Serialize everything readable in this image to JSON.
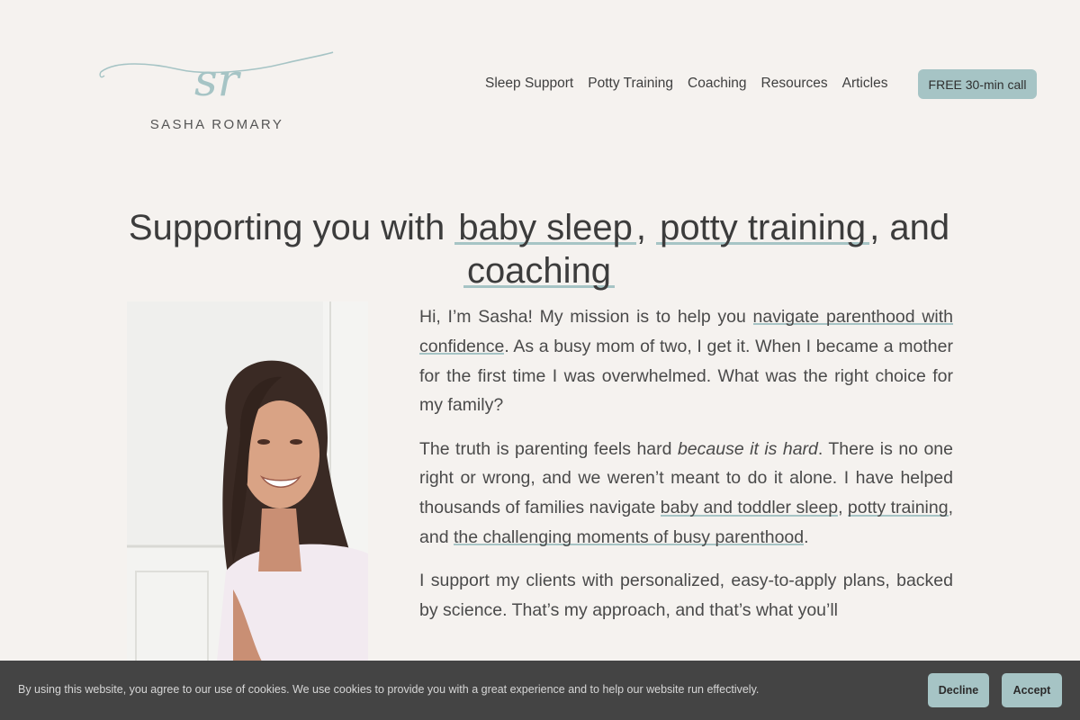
{
  "brand": {
    "monogram": "sr",
    "name": "SASHA ROMARY"
  },
  "nav": {
    "items": [
      "Sleep Support",
      "Potty Training",
      "Coaching",
      "Resources",
      "Articles"
    ],
    "cta": "FREE 30-min call"
  },
  "hero": {
    "headline_prefix": "Supporting you with ",
    "link1": "baby sleep",
    "sep1": ", ",
    "link2": "potty training",
    "sep2": ", and",
    "link3": "coaching"
  },
  "about": {
    "p1_link": "navigate parenthood with confidence",
    "p1_a": "Hi, I’m Sasha! My mission is to help you ",
    "p1_b": ". As a busy mom of two, I get it. When I became a mother for the first time I was overwhelmed. What was the right choice for my family?",
    "p2_a": "The truth is parenting feels hard ",
    "p2_em": "because it is hard",
    "p2_b": ". There is no one right or wrong, and we weren’t meant to do it alone. I have helped thousands of families navigate ",
    "p2_link1": "baby and toddler sleep",
    "p2_c": ", ",
    "p2_link2": "potty training",
    "p2_d": ", and ",
    "p2_link3": "the challenging moments of busy parenthood",
    "p2_e": ".",
    "p3": "I support my clients with personalized, easy-to-apply plans, backed by science. That’s my approach, and that’s what you’ll"
  },
  "cookie": {
    "text": "By using this website, you agree to our use of cookies. We use cookies to provide you with a great experience and to help our website run effectively.",
    "decline": "Decline",
    "accept": "Accept"
  },
  "colors": {
    "accent": "#a6c4c5",
    "background": "#f5f2ef",
    "cookie_bar": "#444444"
  }
}
